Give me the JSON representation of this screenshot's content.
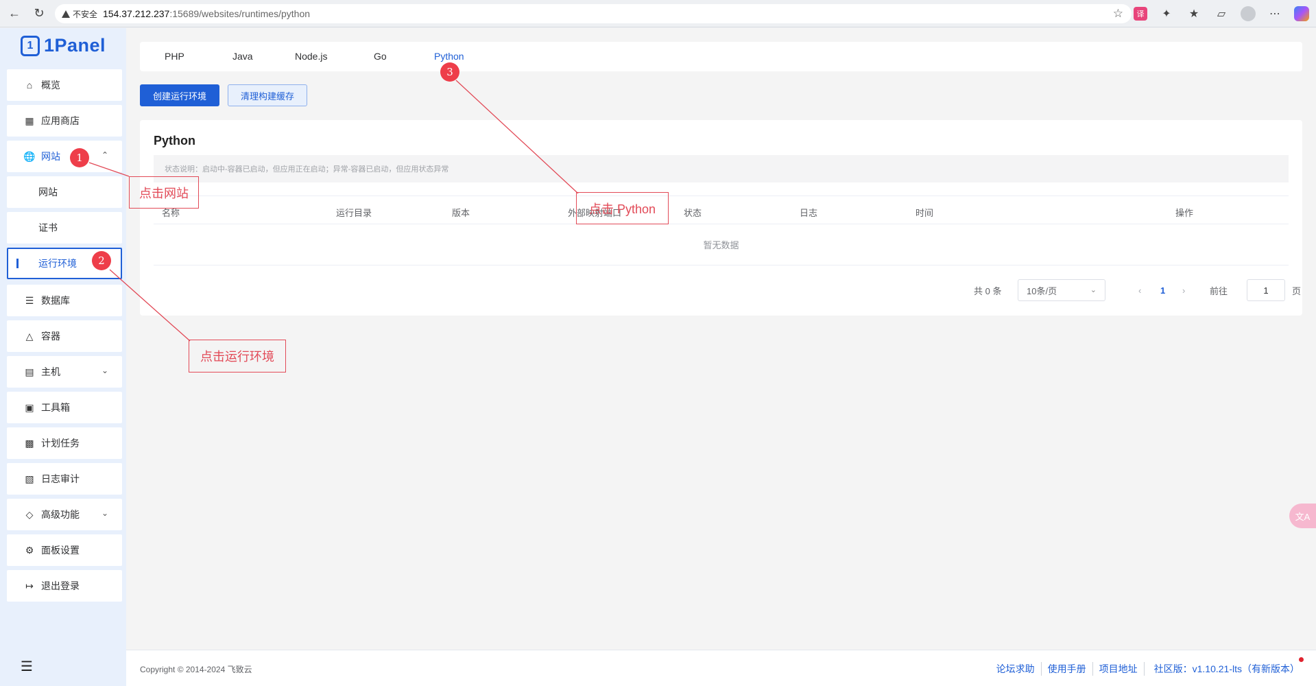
{
  "browser": {
    "security_label": "不安全",
    "url_host": "154.37.212.237",
    "url_rest": ":15689/websites/runtimes/python"
  },
  "sidebar": {
    "logo_text": "1Panel",
    "items": [
      {
        "label": "概览"
      },
      {
        "label": "应用商店"
      },
      {
        "label": "网站"
      },
      {
        "label": "网站"
      },
      {
        "label": "证书"
      },
      {
        "label": "运行环境"
      },
      {
        "label": "数据库"
      },
      {
        "label": "容器"
      },
      {
        "label": "主机"
      },
      {
        "label": "工具箱"
      },
      {
        "label": "计划任务"
      },
      {
        "label": "日志审计"
      },
      {
        "label": "高级功能"
      },
      {
        "label": "面板设置"
      },
      {
        "label": "退出登录"
      }
    ]
  },
  "tabs": [
    "PHP",
    "Java",
    "Node.js",
    "Go",
    "Python"
  ],
  "toolbar": {
    "create_label": "创建运行环境",
    "clear_label": "清理构建缓存"
  },
  "card": {
    "title": "Python",
    "status_note": "状态说明：启动中-容器已启动，但应用正在启动；异常-容器已启动，但应用状态异常",
    "columns": [
      "名称",
      "运行目录",
      "版本",
      "外部映射端口",
      "状态",
      "日志",
      "时间",
      "操作"
    ],
    "empty_text": "暂无数据"
  },
  "pagination": {
    "total": "共 0 条",
    "page_size": "10条/页",
    "current_page": "1",
    "goto_label": "前往",
    "goto_value": "1",
    "page_unit": "页"
  },
  "footer": {
    "copyright": "Copyright © 2014-2024 飞致云",
    "links": [
      "论坛求助",
      "使用手册",
      "项目地址"
    ],
    "edition_label": "社区版：",
    "version": "v1.10.21-lts",
    "new_version": "（有新版本）"
  },
  "floating": {
    "translate_label": "文A"
  },
  "annotations": {
    "step1": "1",
    "step2": "2",
    "step3": "3",
    "callout1": "点击网站",
    "callout2": "点击运行环境",
    "callout3": "点击 Python"
  },
  "colors": {
    "accent": "#1f5fd6",
    "annotation": "#e24a57"
  }
}
